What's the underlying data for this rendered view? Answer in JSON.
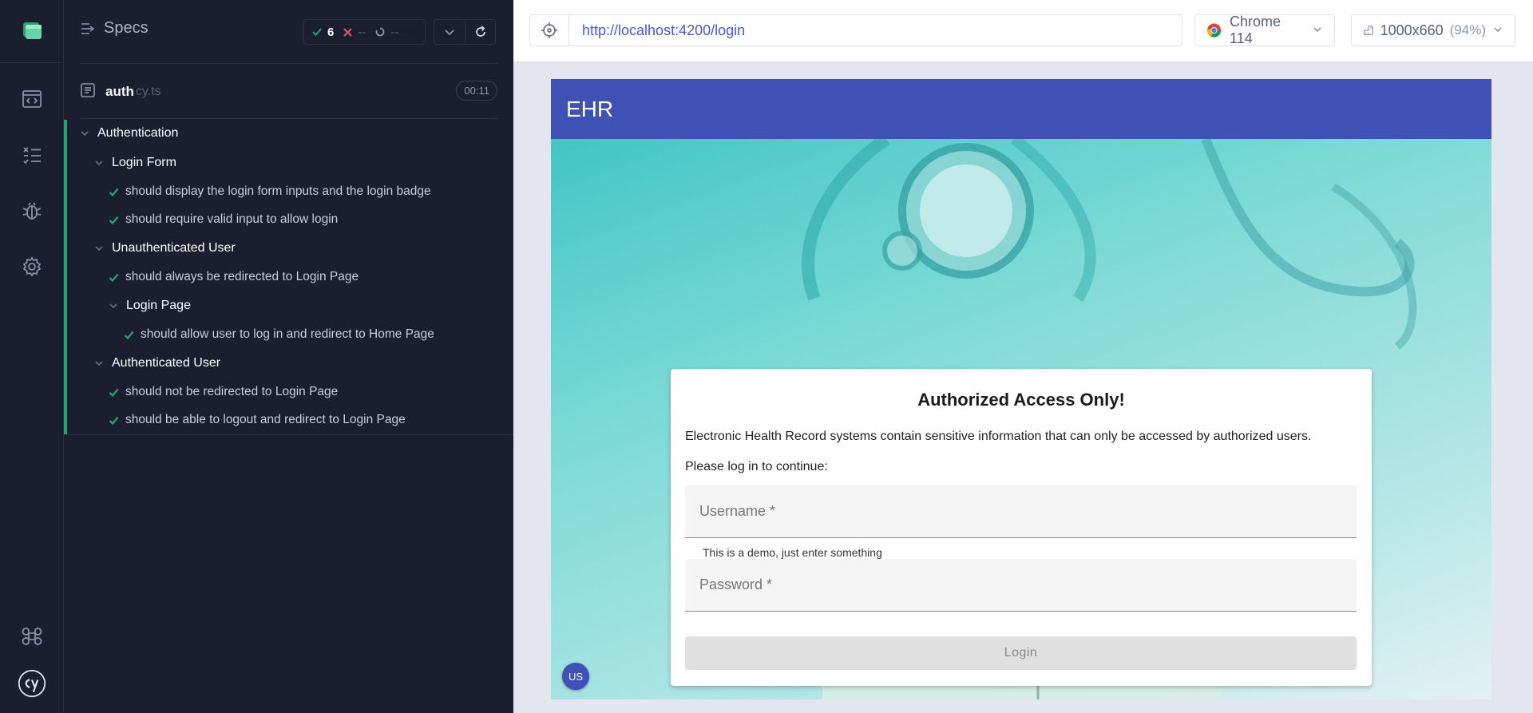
{
  "reporter": {
    "header_title": "Specs",
    "stats": {
      "passed": "6",
      "failed": "--",
      "pending": "--"
    },
    "spec_file": {
      "name": "auth",
      "ext": "cy.ts",
      "duration": "00:11"
    },
    "tree": [
      {
        "label": "Authentication",
        "kind": "suite"
      },
      {
        "label": "Login Form",
        "kind": "suite"
      },
      {
        "label": "should display the login form inputs and the login badge",
        "kind": "test"
      },
      {
        "label": "should require valid input to allow login",
        "kind": "test"
      },
      {
        "label": "Unauthenticated User",
        "kind": "suite"
      },
      {
        "label": "should always be redirected to Login Page",
        "kind": "test"
      },
      {
        "label": "Login Page",
        "kind": "suite"
      },
      {
        "label": "should allow user to log in and redirect to Home Page",
        "kind": "test"
      },
      {
        "label": "Authenticated User",
        "kind": "suite"
      },
      {
        "label": "should not be redirected to Login Page",
        "kind": "test"
      },
      {
        "label": "should be able to logout and redirect to Login Page",
        "kind": "test"
      }
    ]
  },
  "browser": {
    "url": "http://localhost:4200/login",
    "browser_name": "Chrome 114",
    "viewport": "1000x660",
    "scale": "(94%)"
  },
  "app": {
    "title": "EHR",
    "card_title": "Authorized Access Only!",
    "description": "Electronic Health Record systems contain sensitive information that can only be accessed by authorized users.",
    "prompt": "Please log in to continue:",
    "username_placeholder": "Username *",
    "username_hint": "This is a demo, just enter something",
    "password_placeholder": "Password *",
    "login_label": "Login",
    "badge": "US"
  },
  "colors": {
    "accent_green": "#1fa971",
    "fail_red": "#e45770",
    "app_primary": "#3f51b5",
    "url_blue": "#4956e3"
  },
  "icons": {
    "rail": [
      "app-logo-icon",
      "specs-icon",
      "runs-icon",
      "debug-icon",
      "settings-icon",
      "keyboard-shortcuts-icon",
      "cypress-logo-icon"
    ]
  }
}
